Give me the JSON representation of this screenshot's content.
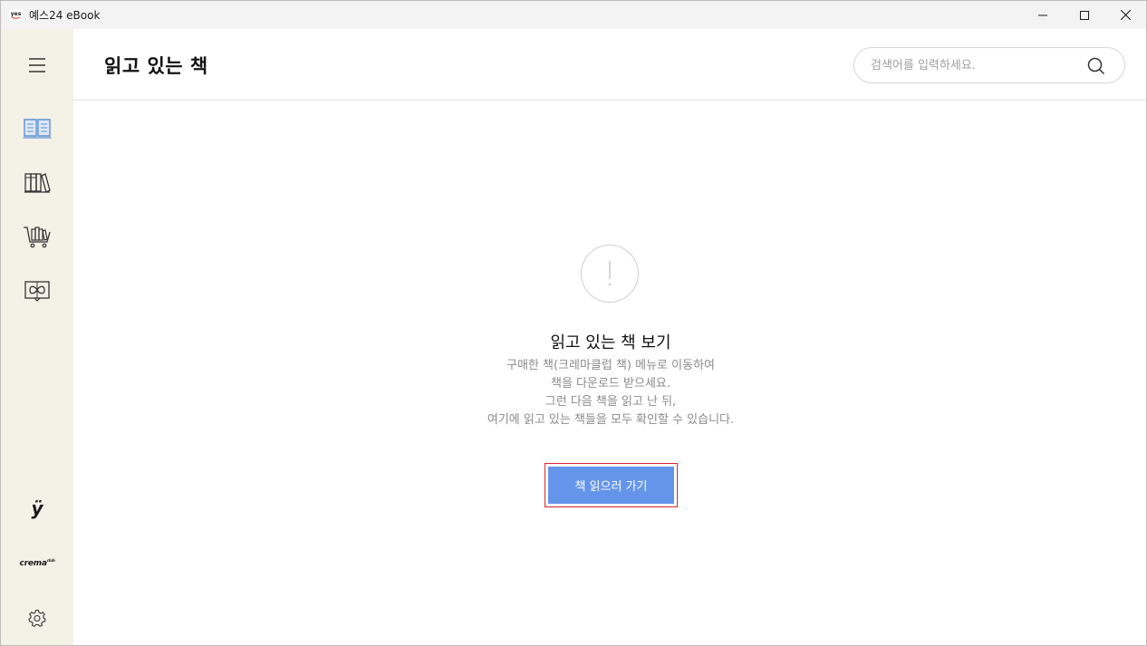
{
  "window": {
    "title": "예스24 eBook",
    "icon_label": "yes"
  },
  "sidebar": {
    "items": [
      {
        "name": "reading-books",
        "icon": "open-book-icon",
        "active": true
      },
      {
        "name": "library",
        "icon": "bookshelf-icon",
        "active": false
      },
      {
        "name": "store",
        "icon": "book-cart-icon",
        "active": false
      },
      {
        "name": "crema-club",
        "icon": "infinity-book-icon",
        "active": false
      }
    ],
    "yes_logo": "ÿ",
    "crema_logo": "crema",
    "crema_logo_sup": "club",
    "settings_icon": "gear-icon"
  },
  "header": {
    "title": "읽고 있는 책",
    "search": {
      "placeholder": "검색어를 입력하세요.",
      "value": ""
    }
  },
  "empty_state": {
    "icon": "exclamation-icon",
    "title": "읽고 있는 책 보기",
    "description": [
      "구매한 책(크레마클럽 책) 메뉴로 이동하여",
      "책을 다운로드 받으세요.",
      "그런 다음 책을 읽고 난 뒤,",
      "여기에 읽고 있는 책들을 모두 확인할 수 있습니다."
    ],
    "button_label": "책 읽으러 가기"
  },
  "colors": {
    "sidebar_bg": "#f4f1e7",
    "accent": "#6495ea",
    "active_icon": "#5b8fd6",
    "highlight_border": "#d9262c"
  }
}
